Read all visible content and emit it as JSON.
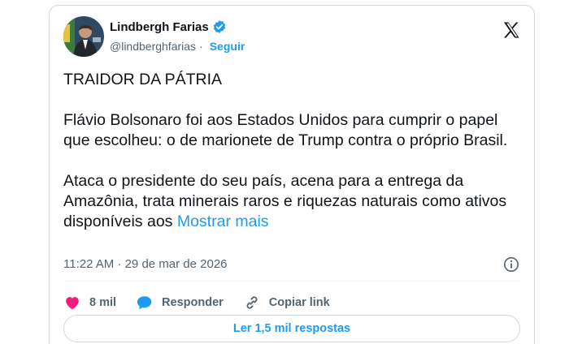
{
  "author": {
    "name": "Lindbergh Farias",
    "handle": "@lindberghfarias",
    "separator": "·",
    "follow_label": "Seguir"
  },
  "tweet": {
    "paragraphs": [
      "TRAIDOR DA PÁTRIA",
      "Flávio Bolsonaro foi aos Estados Unidos para cumprir o papel que escolheu: o de marionete de Trump contra o próprio Brasil.",
      "Ataca o presidente do seu país, acena para a entrega da Amazônia, trata minerais raros e riquezas naturais como ativos disponíveis aos"
    ],
    "show_more": "Mostrar mais",
    "timestamp": "11:22 AM · 29 de mar de 2026"
  },
  "actions": {
    "likes": "8 mil",
    "reply": "Responder",
    "copy_link": "Copiar link"
  },
  "replies_button": "Ler 1,5 mil respostas",
  "colors": {
    "accent": "#1d9bf0",
    "like": "#f91880",
    "text": "#0f1419",
    "muted": "#536471",
    "border": "#cfd9de"
  },
  "icons": [
    "verified-badge-icon",
    "x-logo-icon",
    "info-icon",
    "heart-icon",
    "reply-bubble-icon",
    "link-icon"
  ]
}
